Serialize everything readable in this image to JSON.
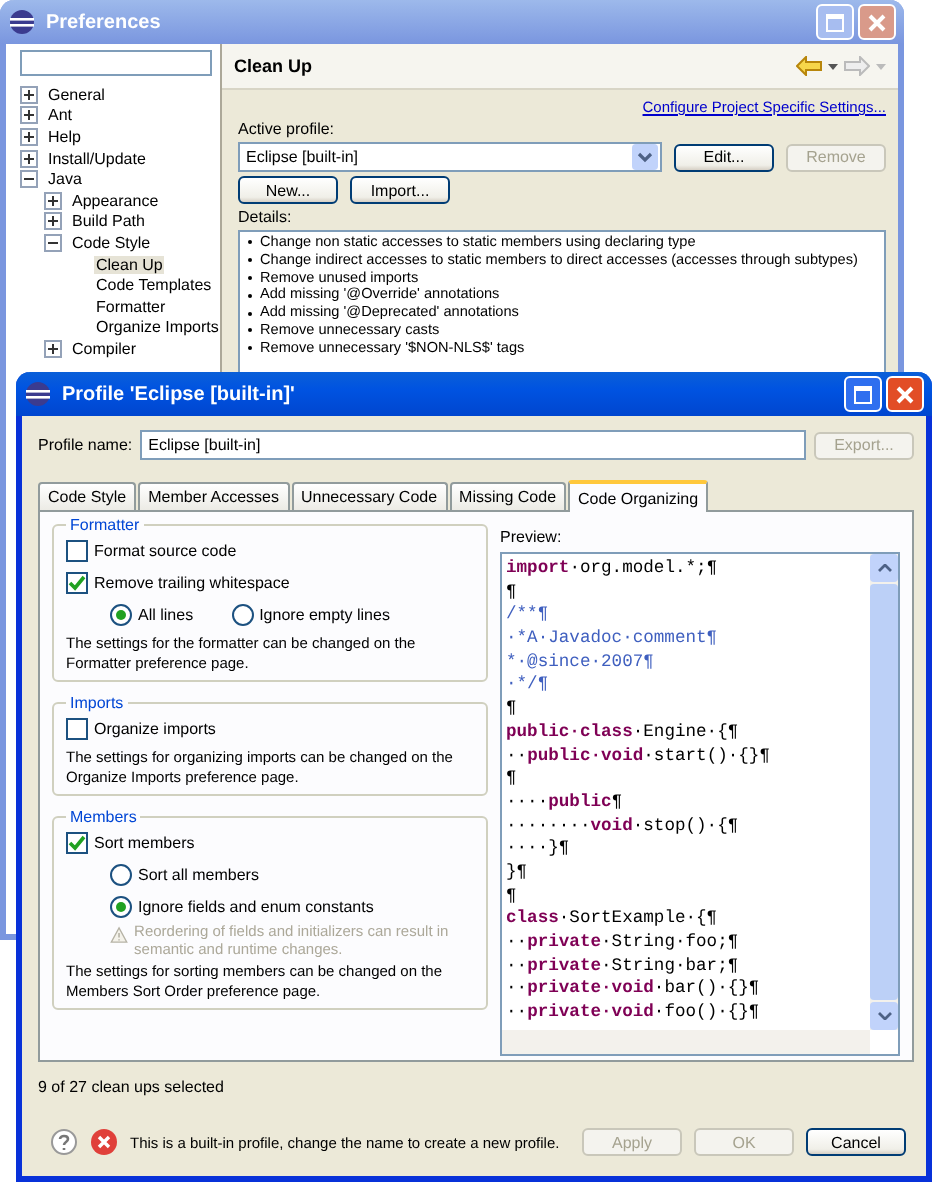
{
  "preferences": {
    "title": "Preferences",
    "tree": [
      {
        "label": "General",
        "expanded": false,
        "selected": false
      },
      {
        "label": "Ant",
        "expanded": false,
        "selected": false
      },
      {
        "label": "Help",
        "expanded": false,
        "selected": false
      },
      {
        "label": "Install/Update",
        "expanded": false,
        "selected": false
      },
      {
        "label": "Java",
        "expanded": true,
        "selected": false,
        "children": [
          {
            "label": "Appearance",
            "expanded": false,
            "selected": false
          },
          {
            "label": "Build Path",
            "expanded": false,
            "selected": false
          },
          {
            "label": "Code Style",
            "expanded": true,
            "selected": false,
            "children": [
              {
                "label": "Clean Up",
                "selected": true
              },
              {
                "label": "Code Templates",
                "selected": false
              },
              {
                "label": "Formatter",
                "selected": false
              },
              {
                "label": "Organize Imports",
                "selected": false
              }
            ]
          },
          {
            "label": "Compiler",
            "expanded": false,
            "selected": false
          }
        ]
      }
    ],
    "page_title": "Clean Up",
    "link": "Configure Project Specific Settings...",
    "profile_label": "Active profile:",
    "profile_value": "Eclipse [built-in]",
    "profile_buttons": [
      {
        "label": "Edit...",
        "disabled": false
      },
      {
        "label": "Remove",
        "disabled": true
      }
    ],
    "buttons": [
      {
        "label": "New...",
        "disabled": false
      },
      {
        "label": "Import...",
        "disabled": false
      }
    ],
    "details_label": "Details:",
    "details": [
      "Change non static accesses to static members using declaring type",
      "Change indirect accesses to static members to direct accesses (accesses through subtypes)",
      "Remove unused imports",
      "Add missing '@Override' annotations",
      "Add missing '@Deprecated' annotations",
      "Remove unnecessary casts",
      "Remove unnecessary '$NON-NLS$' tags"
    ]
  },
  "dialog": {
    "title": "Profile 'Eclipse [built-in]'",
    "profile_name_label": "Profile name:",
    "profile_name": "Eclipse [built-in]",
    "export": {
      "label": "Export...",
      "disabled": true
    },
    "tabs": [
      {
        "label": "Code Style",
        "selected": false
      },
      {
        "label": "Member Accesses",
        "selected": false
      },
      {
        "label": "Unnecessary Code",
        "selected": false
      },
      {
        "label": "Missing Code",
        "selected": false
      },
      {
        "label": "Code Organizing",
        "selected": true
      }
    ],
    "groups": [
      {
        "title": "Formatter",
        "options": [
          {
            "kind": "checkbox",
            "label": "Format source code",
            "checked": false
          },
          {
            "kind": "checkbox",
            "label": "Remove trailing whitespace",
            "checked": true
          },
          {
            "kind": "radio_row",
            "items": [
              {
                "label": "All lines",
                "selected": true
              },
              {
                "label": "Ignore empty lines",
                "selected": false
              }
            ]
          }
        ],
        "note": "The settings for the formatter can be changed on the Formatter preference page."
      },
      {
        "title": "Imports",
        "options": [
          {
            "kind": "checkbox",
            "label": "Organize imports",
            "checked": false
          }
        ],
        "note": "The settings for organizing imports can be changed on the Organize Imports preference page."
      },
      {
        "title": "Members",
        "options": [
          {
            "kind": "checkbox",
            "label": "Sort members",
            "checked": true
          },
          {
            "kind": "radio",
            "label": "Sort all members",
            "selected": false
          },
          {
            "kind": "radio",
            "label": "Ignore fields and enum constants",
            "selected": true
          },
          {
            "kind": "warning",
            "label": "Reordering of fields and initializers can result in semantic and runtime changes.",
            "disabled": true
          }
        ],
        "note": "The settings for sorting members can be changed on the Members Sort Order preference page."
      }
    ],
    "preview_label": "Preview:",
    "preview": [
      [
        {
          "kind": "keyword",
          "text": "import"
        },
        {
          "kind": "plain",
          "text": "·org.model.*;¶"
        }
      ],
      [
        {
          "kind": "plain",
          "text": "¶"
        }
      ],
      [
        {
          "kind": "comment",
          "text": "/**¶"
        }
      ],
      [
        {
          "kind": "comment",
          "text": "·*A·Javadoc·comment¶"
        }
      ],
      [
        {
          "kind": "comment",
          "text": "*·@since·2007¶"
        }
      ],
      [
        {
          "kind": "comment",
          "text": "·*/¶"
        }
      ],
      [
        {
          "kind": "plain",
          "text": "¶"
        }
      ],
      [
        {
          "kind": "keyword",
          "text": "public·class"
        },
        {
          "kind": "plain",
          "text": "·Engine·{¶"
        }
      ],
      [
        {
          "kind": "plain",
          "text": "··"
        },
        {
          "kind": "keyword",
          "text": "public·void"
        },
        {
          "kind": "plain",
          "text": "·start()·{}¶"
        }
      ],
      [
        {
          "kind": "plain",
          "text": "¶"
        }
      ],
      [
        {
          "kind": "plain",
          "text": "····"
        },
        {
          "kind": "keyword",
          "text": "public"
        },
        {
          "kind": "plain",
          "text": "¶"
        }
      ],
      [
        {
          "kind": "plain",
          "text": "········"
        },
        {
          "kind": "keyword",
          "text": "void"
        },
        {
          "kind": "plain",
          "text": "·stop()·{¶"
        }
      ],
      [
        {
          "kind": "plain",
          "text": "····}¶"
        }
      ],
      [
        {
          "kind": "plain",
          "text": "}¶"
        }
      ],
      [
        {
          "kind": "plain",
          "text": "¶"
        }
      ],
      [
        {
          "kind": "keyword",
          "text": "class"
        },
        {
          "kind": "plain",
          "text": "·SortExample·{¶"
        }
      ],
      [
        {
          "kind": "plain",
          "text": "··"
        },
        {
          "kind": "keyword",
          "text": "private"
        },
        {
          "kind": "plain",
          "text": "·String·foo;¶"
        }
      ],
      [
        {
          "kind": "plain",
          "text": "··"
        },
        {
          "kind": "keyword",
          "text": "private"
        },
        {
          "kind": "plain",
          "text": "·String·bar;¶"
        }
      ],
      [
        {
          "kind": "plain",
          "text": "··"
        },
        {
          "kind": "keyword",
          "text": "private·void"
        },
        {
          "kind": "plain",
          "text": "·bar()·{}¶"
        }
      ],
      [
        {
          "kind": "plain",
          "text": "··"
        },
        {
          "kind": "keyword",
          "text": "private·void"
        },
        {
          "kind": "plain",
          "text": "·foo()·{}¶"
        }
      ]
    ],
    "status": "9 of 27 clean ups selected",
    "message": "This is a built-in profile, change the name to create a new profile.",
    "buttons": [
      {
        "label": "Apply",
        "disabled": true
      },
      {
        "label": "OK",
        "disabled": true
      },
      {
        "label": "Cancel",
        "disabled": false
      }
    ]
  }
}
